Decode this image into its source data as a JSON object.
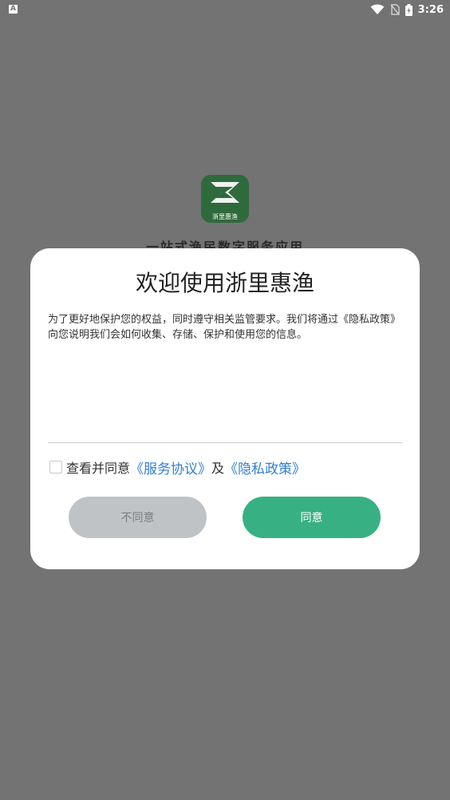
{
  "status_bar": {
    "left_icon_letter": "A",
    "time": "3:26",
    "icons": [
      "wifi-icon",
      "no-sim-icon",
      "battery-charging-icon"
    ]
  },
  "splash": {
    "logo_caption": "浙里惠渔",
    "slogan": "一站式渔民数字服务应用",
    "logo_color": "#2e6a3c"
  },
  "dialog": {
    "title": "欢迎使用浙里惠渔",
    "body": "为了更好地保护您的权益，同时遵守相关监管要求。我们将通过《隐私政策》向您说明我们会如何收集、存储、保护和使用您的信息。",
    "agree_prefix": "查看并同意",
    "service_agreement": "《服务协议》",
    "and_text": "及",
    "privacy_policy": "《隐私政策》",
    "disagree_label": "不同意",
    "agree_label": "同意",
    "accent_color": "#37b184",
    "link_color": "#2f7fd1"
  }
}
